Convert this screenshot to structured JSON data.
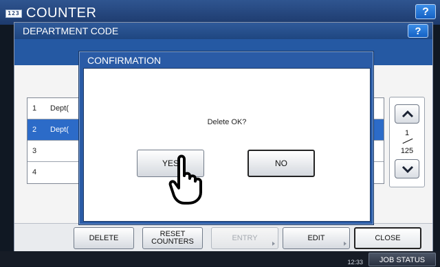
{
  "app": {
    "title": "COUNTER",
    "icon_text": "123",
    "help_label": "?"
  },
  "department": {
    "title": "DEPARTMENT CODE",
    "help_label": "?",
    "rows": [
      {
        "num": "1",
        "name": "Dept(",
        "selected": false
      },
      {
        "num": "2",
        "name": "Dept(",
        "selected": true
      },
      {
        "num": "3",
        "name": "",
        "selected": false
      },
      {
        "num": "4",
        "name": "",
        "selected": false
      }
    ],
    "pager": {
      "current": "1",
      "total": "125"
    },
    "buttons": {
      "delete": "DELETE",
      "reset_line1": "RESET",
      "reset_line2": "COUNTERS",
      "entry": "ENTRY",
      "edit": "EDIT",
      "close": "CLOSE"
    }
  },
  "dialog": {
    "title": "CONFIRMATION",
    "message": "Delete OK?",
    "yes": "YES",
    "no": "NO"
  },
  "status_bar": {
    "time": "12:33",
    "job_status": "JOB STATUS"
  },
  "colors": {
    "header_blue": "#1f4680",
    "dialog_blue": "#2a5ba6",
    "selected_row": "#2c6bc8",
    "help_button": "#1561c4"
  }
}
